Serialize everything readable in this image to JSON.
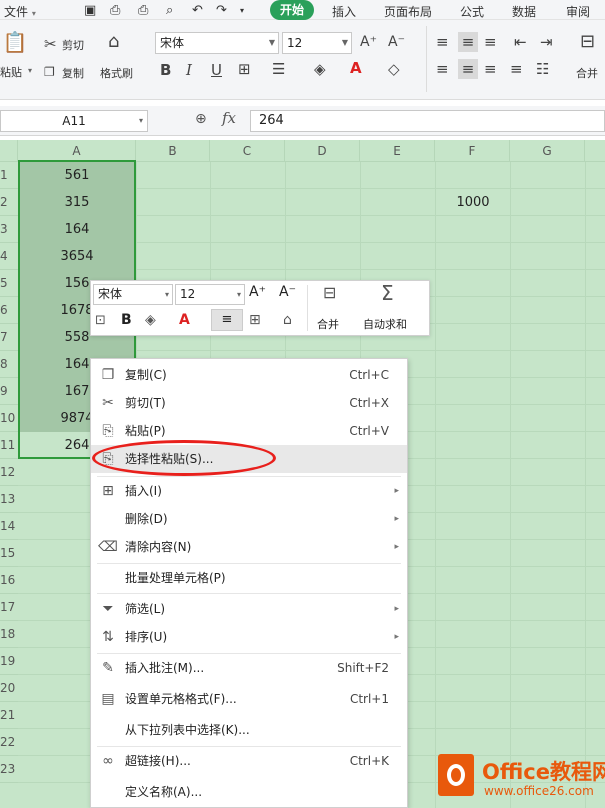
{
  "menubar": {
    "file": "文件",
    "tabs": [
      "开始",
      "插入",
      "页面布局",
      "公式",
      "数据",
      "审阅"
    ]
  },
  "ribbon": {
    "paste": "粘贴",
    "cut": "剪切",
    "copy": "复制",
    "format_painter": "格式刷",
    "font": "宋体",
    "size": "12",
    "bold": "B",
    "italic": "I",
    "underline": "U",
    "font_color_letter": "A",
    "grow": "A⁺",
    "shrink": "A⁻",
    "merge": "合并"
  },
  "formula": {
    "cell_ref": "A11",
    "fx": "fx",
    "value": "264"
  },
  "columns": [
    "A",
    "B",
    "C",
    "D",
    "E",
    "F",
    "G"
  ],
  "rows": [
    "1",
    "2",
    "3",
    "4",
    "5",
    "6",
    "7",
    "8",
    "9",
    "10",
    "11",
    "12",
    "13",
    "14",
    "15",
    "16",
    "17",
    "18",
    "19",
    "20",
    "21",
    "22",
    "23"
  ],
  "cells": {
    "a": [
      "561",
      "315",
      "164",
      "3654",
      "156",
      "1678",
      "558",
      "164",
      "167",
      "9874",
      "264"
    ],
    "f2": "1000"
  },
  "mini": {
    "font": "宋体",
    "size": "12",
    "grow": "A⁺",
    "shrink": "A⁻",
    "merge": "合并",
    "autosum": "自动求和",
    "bold": "B",
    "font_color_letter": "A"
  },
  "ctx": [
    {
      "label": "复制(C)",
      "shortcut": "Ctrl+C",
      "icon": "copy-icon"
    },
    {
      "label": "剪切(T)",
      "shortcut": "Ctrl+X",
      "icon": "scissors-icon"
    },
    {
      "label": "粘贴(P)",
      "shortcut": "Ctrl+V",
      "icon": "paste-icon"
    },
    {
      "label": "选择性粘贴(S)...",
      "shortcut": "",
      "icon": "paste-special-icon"
    },
    {
      "label": "插入(I)",
      "shortcut": "",
      "icon": "insert-icon"
    },
    {
      "label": "删除(D)",
      "shortcut": "",
      "icon": ""
    },
    {
      "label": "清除内容(N)",
      "shortcut": "",
      "icon": "eraser-icon"
    },
    {
      "label": "批量处理单元格(P)",
      "shortcut": "",
      "icon": ""
    },
    {
      "label": "筛选(L)",
      "shortcut": "",
      "icon": "filter-icon"
    },
    {
      "label": "排序(U)",
      "shortcut": "",
      "icon": "sort-icon"
    },
    {
      "label": "插入批注(M)...",
      "shortcut": "Shift+F2",
      "icon": "comment-icon"
    },
    {
      "label": "设置单元格格式(F)...",
      "shortcut": "Ctrl+1",
      "icon": "format-cells-icon"
    },
    {
      "label": "从下拉列表中选择(K)...",
      "shortcut": "",
      "icon": ""
    },
    {
      "label": "超链接(H)...",
      "shortcut": "Ctrl+K",
      "icon": "link-icon"
    },
    {
      "label": "定义名称(A)...",
      "shortcut": "",
      "icon": ""
    }
  ],
  "watermark": {
    "brand": "Office教程网",
    "url": "www.office26.com"
  },
  "colors": {
    "accent": "#2aa05a",
    "grid_bg": "#c6e5c9",
    "selection": "#a3c6a6",
    "selection_border": "#2f9a3b",
    "annotation": "#e8201c",
    "watermark": "#e8590c"
  }
}
